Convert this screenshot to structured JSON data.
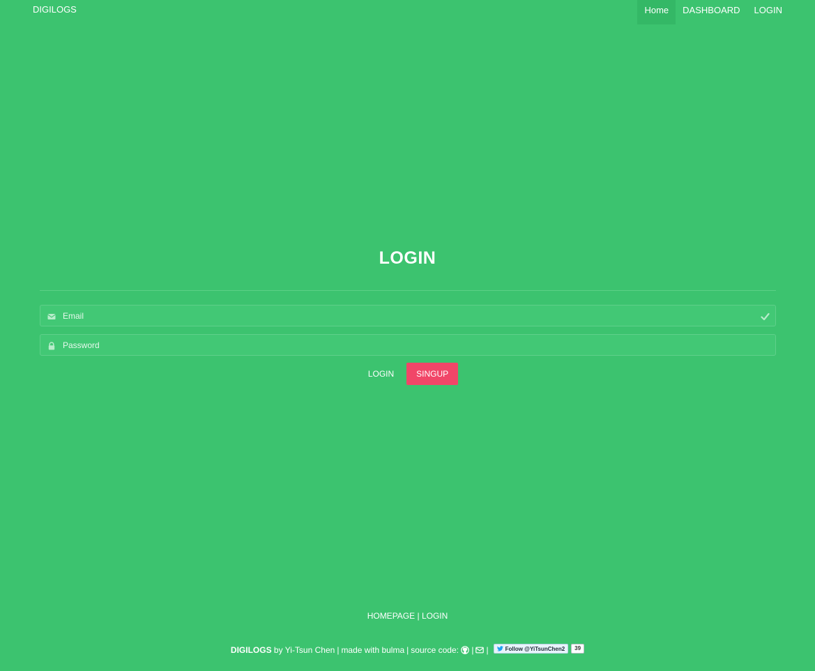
{
  "navbar": {
    "brand": "DIGILOGS",
    "items": [
      {
        "label": "Home",
        "active": true
      },
      {
        "label": "DASHBOARD",
        "active": false
      },
      {
        "label": "LOGIN",
        "active": false
      }
    ]
  },
  "login": {
    "title": "LOGIN",
    "email_placeholder": "Email",
    "email_value": "",
    "password_placeholder": "Password",
    "password_value": "",
    "login_button": "LOGIN",
    "signup_button": "SINGUP"
  },
  "icons": {
    "email": "envelope-icon",
    "password": "lock-icon",
    "valid": "check-icon",
    "github": "github-icon",
    "mail": "envelope-outline-icon",
    "twitter": "twitter-bird-icon"
  },
  "footer": {
    "links": {
      "homepage": "HOMEPAGE",
      "separator": "|",
      "login": "LOGIN"
    },
    "credit": {
      "brand": "DIGILOGS",
      "author": "by Yi-Tsun Chen",
      "sep1": "|",
      "made_with": "made with bulma",
      "sep2": "|",
      "source_code": "source code:",
      "sep3": "|",
      "sep4": "|"
    },
    "twitter": {
      "follow_label": "Follow @YiTsunChen2",
      "count": "39"
    }
  },
  "colors": {
    "background": "#3cc36f",
    "nav_active": "#34b866",
    "signup": "#f14668",
    "text": "#ffffff"
  }
}
